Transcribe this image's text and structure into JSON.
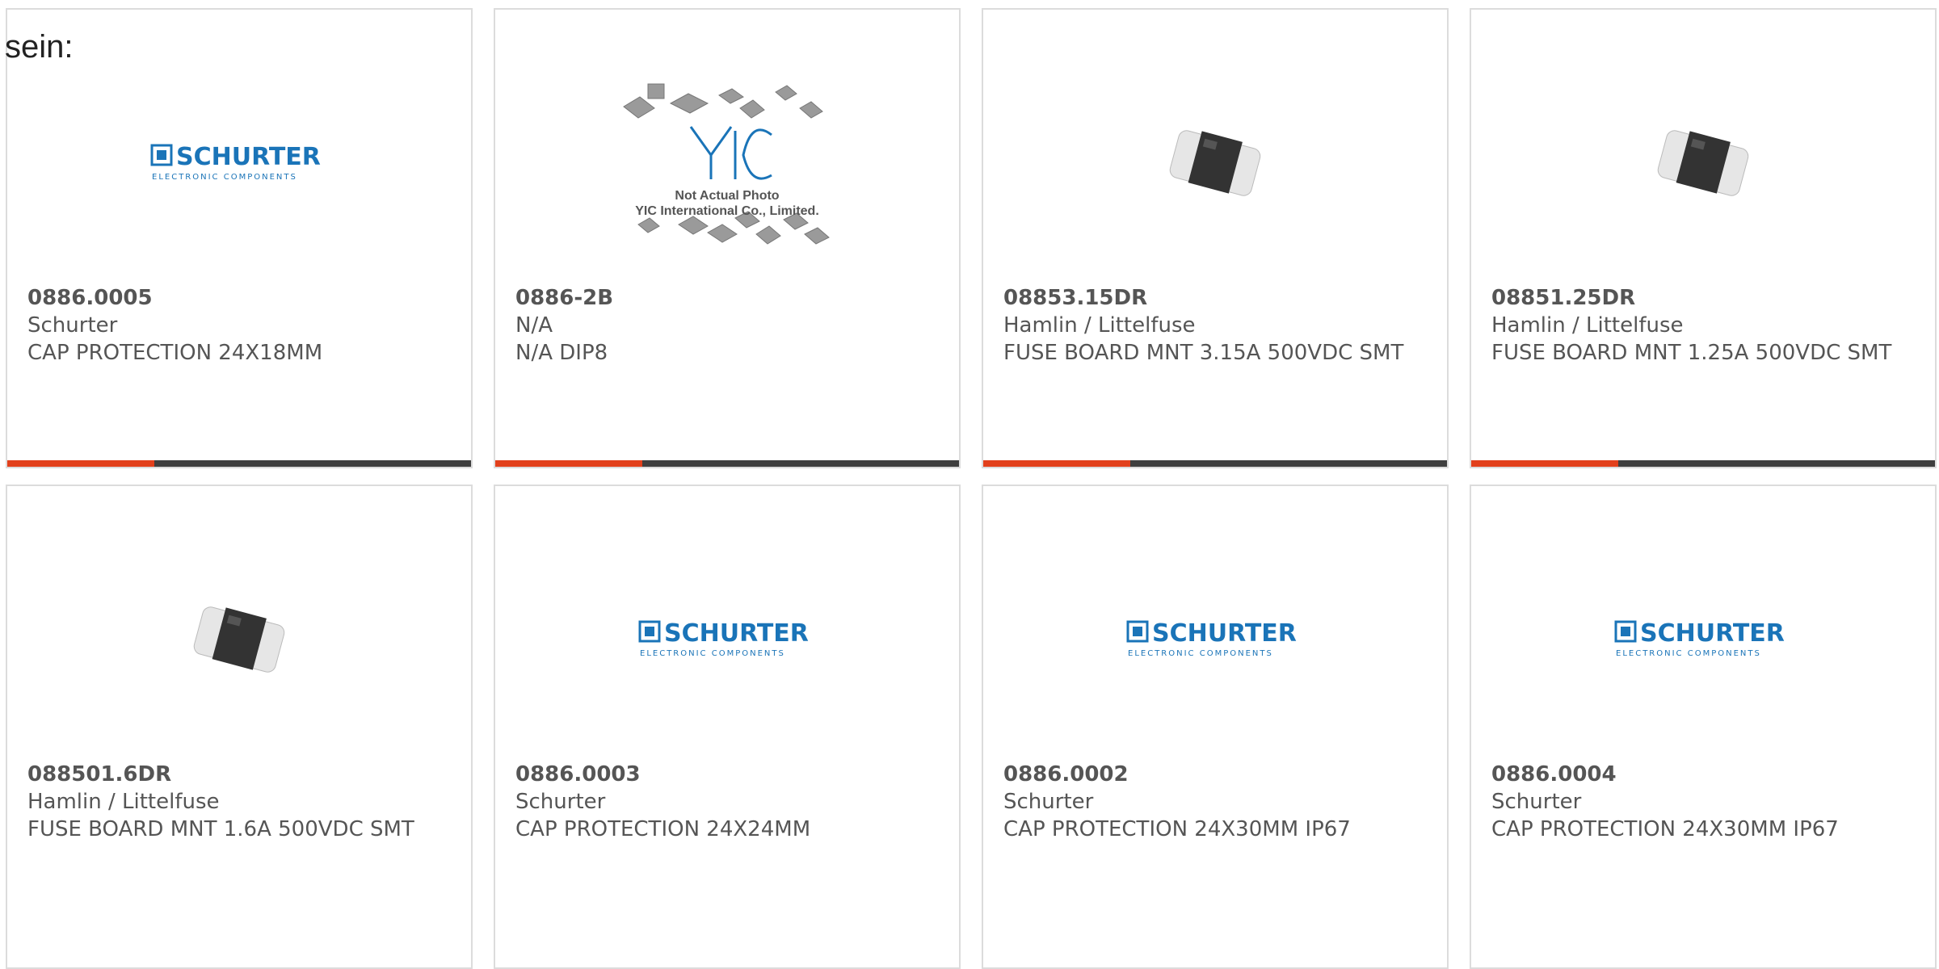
{
  "intro_text": "sein:",
  "colors": {
    "accent": "#e2401c",
    "bar_dark": "#3f3f3f",
    "schurter_blue": "#1a74b8",
    "text": "#555555"
  },
  "products": [
    {
      "part_number": "0886.0005",
      "manufacturer": "Schurter",
      "description": "CAP PROTECTION 24X18MM",
      "image": "schurter-logo"
    },
    {
      "part_number": "0886-2B",
      "manufacturer": "N/A",
      "description": "N/A DIP8",
      "image": "yic-not-actual-photo"
    },
    {
      "part_number": "08853.15DR",
      "manufacturer": "Hamlin / Littelfuse",
      "description": "FUSE BOARD MNT 3.15A 500VDC SMT",
      "image": "smd-fuse-photo"
    },
    {
      "part_number": "08851.25DR",
      "manufacturer": "Hamlin / Littelfuse",
      "description": "FUSE BOARD MNT 1.25A 500VDC SMT",
      "image": "smd-fuse-photo"
    },
    {
      "part_number": "088501.6DR",
      "manufacturer": "Hamlin / Littelfuse",
      "description": "FUSE BOARD MNT 1.6A 500VDC SMT",
      "image": "smd-fuse-photo"
    },
    {
      "part_number": "0886.0003",
      "manufacturer": "Schurter",
      "description": "CAP PROTECTION 24X24MM",
      "image": "schurter-logo"
    },
    {
      "part_number": "0886.0002",
      "manufacturer": "Schurter",
      "description": "CAP PROTECTION 24X30MM IP67",
      "image": "schurter-logo"
    },
    {
      "part_number": "0886.0004",
      "manufacturer": "Schurter",
      "description": "CAP PROTECTION 24X30MM IP67",
      "image": "schurter-logo"
    }
  ],
  "logos": {
    "schurter_name": "SCHURTER",
    "schurter_tagline": "ELECTRONIC COMPONENTS",
    "yic_line1": "Not Actual Photo",
    "yic_line2": "YIC International Co., Limited."
  }
}
